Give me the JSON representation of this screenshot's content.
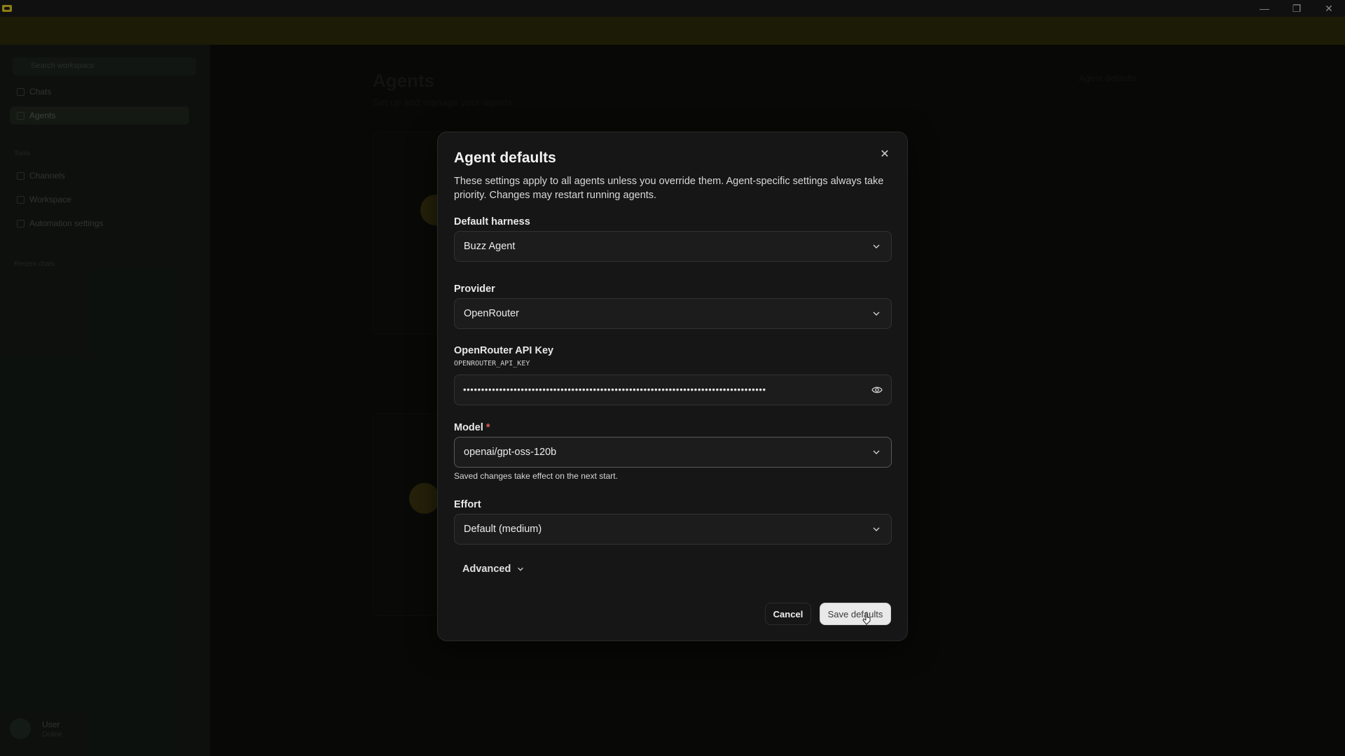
{
  "window": {
    "controls": {
      "minimize": "—",
      "maximize": "❐",
      "close": "✕"
    }
  },
  "background": {
    "sidebar": {
      "search_placeholder": "Search workspace",
      "items": [
        "Chats",
        "Agents"
      ],
      "section_label": "Tools",
      "tools": [
        "Channels",
        "Workspace",
        "Automation settings"
      ],
      "footer_section": "Recent chats",
      "user_name": "User",
      "user_status": "Online"
    },
    "page": {
      "title": "Agents",
      "subtitle": "Set up and manage your agents",
      "action": "Agent defaults"
    }
  },
  "dialog": {
    "title": "Agent defaults",
    "description": "These settings apply to all agents unless you override them. Agent-specific settings always take priority. Changes may restart running agents.",
    "harness": {
      "label": "Default harness",
      "value": "Buzz Agent"
    },
    "provider": {
      "label": "Provider",
      "value": "OpenRouter"
    },
    "api_key": {
      "label": "OpenRouter API Key",
      "env_var": "OPENROUTER_API_KEY",
      "masked_value": "••••••••••••••••••••••••••••••••••••••••••••••••••••••••••••••••••••••••••••••••••••"
    },
    "model": {
      "label": "Model",
      "required_mark": "*",
      "value": "openai/gpt-oss-120b",
      "helper": "Saved changes take effect on the next start."
    },
    "effort": {
      "label": "Effort",
      "value": "Default (medium)"
    },
    "advanced_label": "Advanced",
    "cancel_label": "Cancel",
    "save_label": "Save defaults"
  }
}
